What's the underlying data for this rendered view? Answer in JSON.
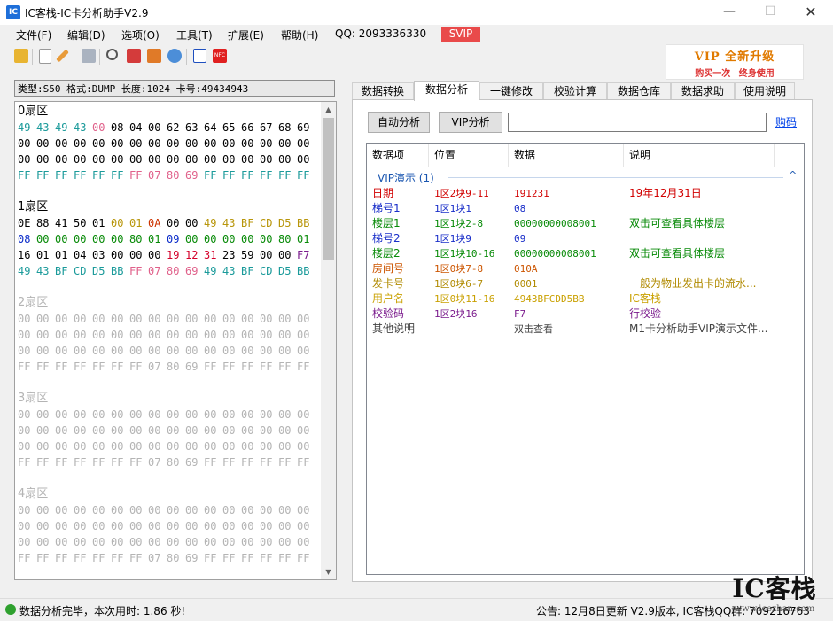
{
  "window": {
    "title": "IC客栈-IC卡分析助手V2.9",
    "icon": "app-logo-icon"
  },
  "menu": {
    "items": [
      "文件(F)",
      "编辑(D)",
      "选项(O)",
      "工具(T)",
      "扩展(E)",
      "帮助(H)"
    ],
    "qq": "QQ: 2093336330",
    "svip": "SVIP"
  },
  "toolbar": {
    "icons": [
      "open-folder-icon",
      "new-file-icon",
      "edit-pen-icon",
      "save-icon",
      "search-icon",
      "calendar-icon",
      "chart-icon",
      "refresh-icon",
      "form-icon",
      "nfc-icon"
    ]
  },
  "vip_banner": {
    "line1": "VIP 全新升级",
    "line2": "购买一次 终身使用"
  },
  "card_info": "类型:S50 格式:DUMP 长度:1024 卡号:49434943",
  "hex": {
    "sectors": [
      {
        "label": "0扇区",
        "dim": false,
        "rows": [
          [
            "49",
            "43",
            "49",
            "43",
            "00",
            "08",
            "04",
            "00",
            "62",
            "63",
            "64",
            "65",
            "66",
            "67",
            "68",
            "69"
          ],
          [
            "00",
            "00",
            "00",
            "00",
            "00",
            "00",
            "00",
            "00",
            "00",
            "00",
            "00",
            "00",
            "00",
            "00",
            "00",
            "00"
          ],
          [
            "00",
            "00",
            "00",
            "00",
            "00",
            "00",
            "00",
            "00",
            "00",
            "00",
            "00",
            "00",
            "00",
            "00",
            "00",
            "00"
          ],
          [
            "FF",
            "FF",
            "FF",
            "FF",
            "FF",
            "FF",
            "FF",
            "07",
            "80",
            "69",
            "FF",
            "FF",
            "FF",
            "FF",
            "FF",
            "FF"
          ]
        ]
      },
      {
        "label": "1扇区",
        "dim": false,
        "rows": [
          [
            "0E",
            "88",
            "41",
            "50",
            "01",
            "00",
            "01",
            "0A",
            "00",
            "00",
            "49",
            "43",
            "BF",
            "CD",
            "D5",
            "BB"
          ],
          [
            "08",
            "00",
            "00",
            "00",
            "00",
            "00",
            "80",
            "01",
            "09",
            "00",
            "00",
            "00",
            "00",
            "00",
            "80",
            "01"
          ],
          [
            "16",
            "01",
            "01",
            "04",
            "03",
            "00",
            "00",
            "00",
            "19",
            "12",
            "31",
            "23",
            "59",
            "00",
            "00",
            "F7"
          ],
          [
            "49",
            "43",
            "BF",
            "CD",
            "D5",
            "BB",
            "FF",
            "07",
            "80",
            "69",
            "49",
            "43",
            "BF",
            "CD",
            "D5",
            "BB"
          ]
        ]
      },
      {
        "label": "2扇区",
        "dim": true,
        "rows": [
          [
            "00",
            "00",
            "00",
            "00",
            "00",
            "00",
            "00",
            "00",
            "00",
            "00",
            "00",
            "00",
            "00",
            "00",
            "00",
            "00"
          ],
          [
            "00",
            "00",
            "00",
            "00",
            "00",
            "00",
            "00",
            "00",
            "00",
            "00",
            "00",
            "00",
            "00",
            "00",
            "00",
            "00"
          ],
          [
            "00",
            "00",
            "00",
            "00",
            "00",
            "00",
            "00",
            "00",
            "00",
            "00",
            "00",
            "00",
            "00",
            "00",
            "00",
            "00"
          ],
          [
            "FF",
            "FF",
            "FF",
            "FF",
            "FF",
            "FF",
            "FF",
            "07",
            "80",
            "69",
            "FF",
            "FF",
            "FF",
            "FF",
            "FF",
            "FF"
          ]
        ]
      },
      {
        "label": "3扇区",
        "dim": true,
        "rows": [
          [
            "00",
            "00",
            "00",
            "00",
            "00",
            "00",
            "00",
            "00",
            "00",
            "00",
            "00",
            "00",
            "00",
            "00",
            "00",
            "00"
          ],
          [
            "00",
            "00",
            "00",
            "00",
            "00",
            "00",
            "00",
            "00",
            "00",
            "00",
            "00",
            "00",
            "00",
            "00",
            "00",
            "00"
          ],
          [
            "00",
            "00",
            "00",
            "00",
            "00",
            "00",
            "00",
            "00",
            "00",
            "00",
            "00",
            "00",
            "00",
            "00",
            "00",
            "00"
          ],
          [
            "FF",
            "FF",
            "FF",
            "FF",
            "FF",
            "FF",
            "FF",
            "07",
            "80",
            "69",
            "FF",
            "FF",
            "FF",
            "FF",
            "FF",
            "FF"
          ]
        ]
      },
      {
        "label": "4扇区",
        "dim": true,
        "rows": [
          [
            "00",
            "00",
            "00",
            "00",
            "00",
            "00",
            "00",
            "00",
            "00",
            "00",
            "00",
            "00",
            "00",
            "00",
            "00",
            "00"
          ],
          [
            "00",
            "00",
            "00",
            "00",
            "00",
            "00",
            "00",
            "00",
            "00",
            "00",
            "00",
            "00",
            "00",
            "00",
            "00",
            "00"
          ],
          [
            "00",
            "00",
            "00",
            "00",
            "00",
            "00",
            "00",
            "00",
            "00",
            "00",
            "00",
            "00",
            "00",
            "00",
            "00",
            "00"
          ],
          [
            "FF",
            "FF",
            "FF",
            "FF",
            "FF",
            "FF",
            "FF",
            "07",
            "80",
            "69",
            "FF",
            "FF",
            "FF",
            "FF",
            "FF",
            "FF"
          ]
        ]
      }
    ],
    "colors": {
      "s0r0": [
        "#1a9a9a",
        "#1a9a9a",
        "#1a9a9a",
        "#1a9a9a",
        "#e0608a",
        "#000",
        "#000",
        "#000",
        "#000",
        "#000",
        "#000",
        "#000",
        "#000",
        "#000",
        "#000",
        "#000"
      ],
      "s0r3": [
        "#1a9a9a",
        "#1a9a9a",
        "#1a9a9a",
        "#1a9a9a",
        "#1a9a9a",
        "#1a9a9a",
        "#e0608a",
        "#e0608a",
        "#e0608a",
        "#e0608a",
        "#1a9a9a",
        "#1a9a9a",
        "#1a9a9a",
        "#1a9a9a",
        "#1a9a9a",
        "#1a9a9a"
      ],
      "s1r0": [
        "#000",
        "#000",
        "#000",
        "#000",
        "#000",
        "#b8960b",
        "#b8960b",
        "#cc3300",
        "#000",
        "#000",
        "#b8960b",
        "#b8960b",
        "#b8960b",
        "#b8960b",
        "#b8960b",
        "#b8960b"
      ],
      "s1r1": [
        "#0a2bc9",
        "#078a07",
        "#078a07",
        "#078a07",
        "#078a07",
        "#078a07",
        "#078a07",
        "#078a07",
        "#0a2bc9",
        "#078a07",
        "#078a07",
        "#078a07",
        "#078a07",
        "#078a07",
        "#078a07",
        "#078a07"
      ],
      "s1r2": [
        "#000",
        "#000",
        "#000",
        "#000",
        "#000",
        "#000",
        "#000",
        "#000",
        "#d4002a",
        "#d4002a",
        "#d4002a",
        "#000",
        "#000",
        "#000",
        "#000",
        "#7a1a8c"
      ],
      "s1r3": [
        "#1a9a9a",
        "#1a9a9a",
        "#1a9a9a",
        "#1a9a9a",
        "#1a9a9a",
        "#1a9a9a",
        "#e0608a",
        "#e0608a",
        "#e0608a",
        "#e0608a",
        "#1a9a9a",
        "#1a9a9a",
        "#1a9a9a",
        "#1a9a9a",
        "#1a9a9a",
        "#1a9a9a"
      ],
      "dim": "#b4b4b4"
    }
  },
  "tabs": [
    "数据转换",
    "数据分析",
    "一键修改",
    "校验计算",
    "数据仓库",
    "数据求助",
    "使用说明"
  ],
  "active_tab": 1,
  "analysis": {
    "auto_button": "自动分析",
    "vip_button": "VIP分析",
    "input_value": "",
    "buy_link": "购码",
    "columns": [
      "数据项",
      "位置",
      "数据",
      "说明"
    ],
    "group": "VIP演示 (1)",
    "rows": [
      {
        "item": "日期",
        "pos": "1区2块9-11",
        "data": "191231",
        "desc": "19年12月31日",
        "color": "#d10000"
      },
      {
        "item": "梯号1",
        "pos": "1区1块1",
        "data": "08",
        "desc": "",
        "color": "#1a2fc9"
      },
      {
        "item": "楼层1",
        "pos": "1区1块2-8",
        "data": "00000000008001",
        "desc": "双击可查看具体楼层",
        "color": "#078a07"
      },
      {
        "item": "梯号2",
        "pos": "1区1块9",
        "data": "09",
        "desc": "",
        "color": "#1a2fc9"
      },
      {
        "item": "楼层2",
        "pos": "1区1块10-16",
        "data": "00000000008001",
        "desc": "双击可查看具体楼层",
        "color": "#078a07"
      },
      {
        "item": "房间号",
        "pos": "1区0块7-8",
        "data": "010A",
        "desc": "",
        "color": "#cc5500"
      },
      {
        "item": "发卡号",
        "pos": "1区0块6-7",
        "data": "0001",
        "desc": "一般为物业发出卡的流水...",
        "color": "#b08a00"
      },
      {
        "item": "用户名",
        "pos": "1区0块11-16",
        "data": "4943BFCDD5BB",
        "desc": "IC客栈",
        "color": "#c9a000"
      },
      {
        "item": "校验码",
        "pos": "1区2块16",
        "data": "F7",
        "desc": "行校验",
        "color": "#7a1a8c"
      },
      {
        "item": "其他说明",
        "pos": "",
        "data": "双击查看",
        "desc": "M1卡分析助手VIP演示文件...",
        "color": "#444444"
      }
    ]
  },
  "status": {
    "message": "数据分析完毕，本次用时: 1.86 秒!",
    "notice": "公告: 12月8日更新 V2.9版本, IC客栈QQ群: 709216763"
  },
  "watermark": {
    "big": "IC客栈",
    "small": "www.icezhan.com"
  }
}
